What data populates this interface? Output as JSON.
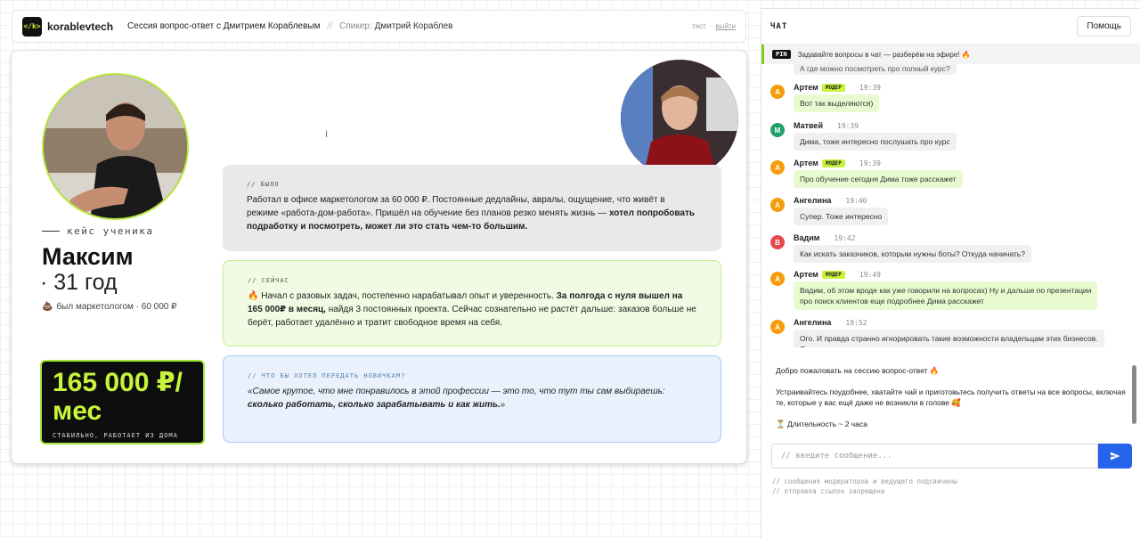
{
  "header": {
    "logo_text": "</k>",
    "brand": "korablevtech",
    "session_title": "Сессия вопрос-ответ с Дмитрием Кораблевым",
    "separator": "//",
    "speaker_label": "Спикер:",
    "speaker_name": "Дмитрий Кораблев",
    "user": "тест",
    "dot": "·",
    "logout": "выйти"
  },
  "slide": {
    "cursor": "I",
    "case_label": "кейс ученика",
    "student_name": "Максим",
    "student_age": "· 31 год",
    "prev_emoji": "💩",
    "prev_job": "был маркетологом · 60 000 ₽",
    "salary": "165 000 ₽/мес",
    "salary_sub": "СТАБИЛЬНО, РАБОТАЕТ ИЗ ДОМА",
    "cards": {
      "before": {
        "label": "// было",
        "text": "Работал в офисе маркетологом за 60 000 ₽. Постоянные дедлайны, авралы, ощущение, что живёт в режиме «работа-дом-работа». Пришёл на обучение без планов резко менять жизнь — ",
        "bold": "хотел попробовать подработку и посмотреть, может ли это стать чем-то большим."
      },
      "now": {
        "label": "// сейчас",
        "emoji": "🔥",
        "text1": " Начал с разовых задач, постепенно нарабатывал опыт и уверенность. ",
        "bold": "За полгода с нуля вышел на 165 000₽ в месяц,",
        "text2": " найдя 3 постоянных проекта. Сейчас сознательно не растёт дальше: заказов больше не берёт, работает удалённо и тратит свободное время на себя."
      },
      "advice": {
        "label": "// что бы хотел передать новичкам?",
        "text": "«Самое крутое, что мне понравилось в этой профессии — это то, что тут ты сам выбираешь: ",
        "bold": "сколько работать, сколько зарабатывать и как жить.",
        "end": "»"
      }
    }
  },
  "chat": {
    "title": "ЧАТ",
    "help_button": "Помощь",
    "pinned_badge": "PIN",
    "pinned_text": "Задавайте вопросы в чат — разберём на эфире! 🔥",
    "partial_message": "А где можно посмотреть про полный курс?",
    "mod_badge": "МОДЕР",
    "messages": [
      {
        "author": "Артем",
        "initial": "А",
        "color": "#f59e0b",
        "mod": true,
        "time": "19:39",
        "text": "Вот так выделяются)"
      },
      {
        "author": "Матвей",
        "initial": "М",
        "color": "#22a06b",
        "mod": false,
        "time": "19:39",
        "text": "Дима, тоже интересно послушать про курс"
      },
      {
        "author": "Артем",
        "initial": "А",
        "color": "#f59e0b",
        "mod": true,
        "time": "19:39",
        "text": "Про обучение сегодня Дима тоже расскажет"
      },
      {
        "author": "Ангелина",
        "initial": "А",
        "color": "#f59e0b",
        "mod": false,
        "time": "19:40",
        "text": "Супер. Тоже интересно"
      },
      {
        "author": "Вадим",
        "initial": "В",
        "color": "#e5484d",
        "mod": false,
        "time": "19:42",
        "text": "Как искать заказчиков, которым нужны боты? Откуда начинать?"
      },
      {
        "author": "Артем",
        "initial": "А",
        "color": "#f59e0b",
        "mod": true,
        "time": "19:49",
        "text": "Вадим, об этом вроде как уже говорили на вопросах) Ну и дальше по презентации\nпро поиск клиентов еще подробнее Дима расскажет"
      },
      {
        "author": "Ангелина",
        "initial": "А",
        "color": "#f59e0b",
        "mod": false,
        "time": "19:52",
        "text": "Ого. И правда странно игнорировать такие возможности владельцам этих бизнесов.\nЯ как то и не задумывалась..."
      }
    ],
    "welcome": {
      "line1": "Добро пожаловать на сессию вопрос-ответ 🔥",
      "line2": "Устраивайтесь поудобнее, хватайте чай и приготовьтесь получить ответы на все вопросы, включая те, которые у вас ещё даже не возникли в голове 🥰",
      "line3": "⏳ Длительность ~ 2 часа"
    },
    "input_placeholder": "// введите сообщение...",
    "notes": [
      "// сообщения модераторов и ведущего подсвечены",
      "// отправка ссылок запрещена"
    ]
  }
}
